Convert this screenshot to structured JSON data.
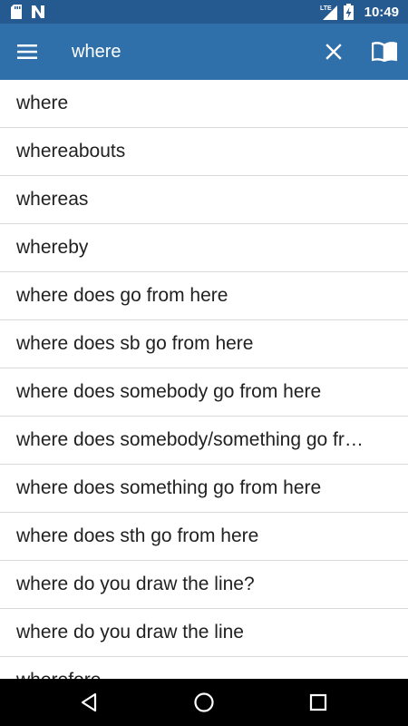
{
  "status_bar": {
    "time": "10:49",
    "network_label": "LTE",
    "icons": [
      "sd-card-icon",
      "n-notification-icon",
      "signal-icon",
      "battery-charging-icon"
    ]
  },
  "toolbar": {
    "search_value": "where",
    "menu_icon": "menu-icon",
    "clear_icon": "close-icon",
    "dictionary_icon": "book-icon"
  },
  "results": [
    "where",
    "whereabouts",
    "whereas",
    "whereby",
    "where does go from here",
    "where does sb go from here",
    "where does somebody go from here",
    "where does somebody/something go from here",
    "where does something go from here",
    "where does sth go from here",
    "where do you draw the line?",
    "where do you draw the line",
    "wherefore"
  ],
  "nav_bar": {
    "icons": [
      "back-icon",
      "home-icon",
      "recents-icon"
    ]
  },
  "colors": {
    "status_bar": "#245a90",
    "toolbar": "#2f6faa",
    "text": "#212121",
    "divider": "#d9d9d9"
  }
}
